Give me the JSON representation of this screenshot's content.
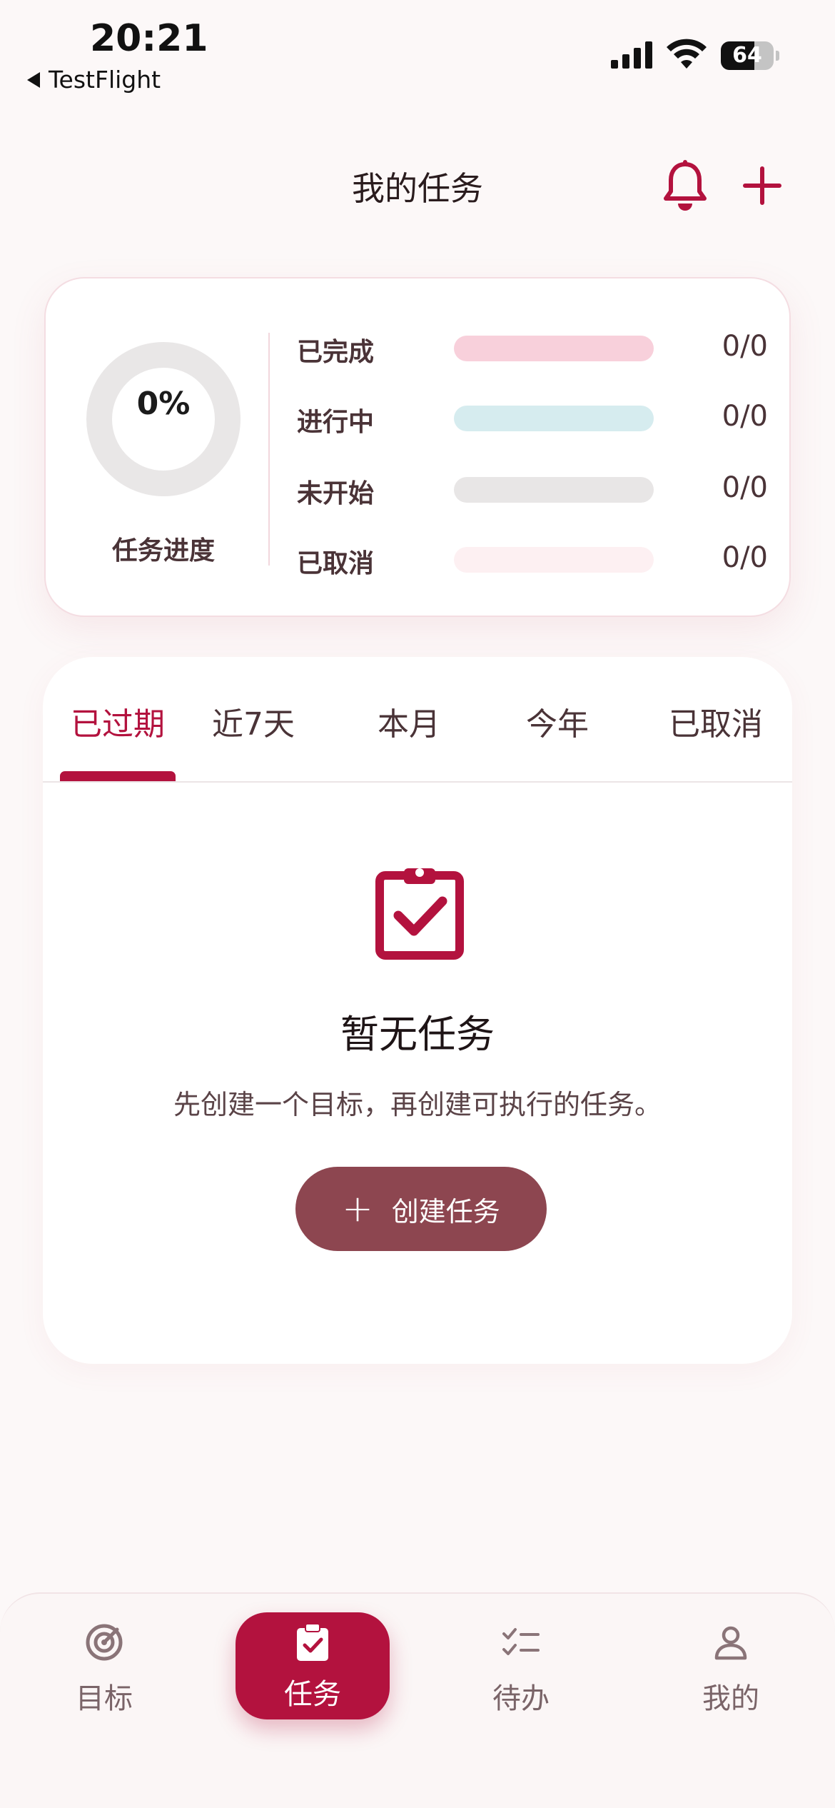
{
  "status_bar": {
    "time": "20:21",
    "back_app": "TestFlight",
    "battery": "64",
    "battery_level": 0.64
  },
  "header": {
    "title": "我的任务",
    "accent_color": "#b3123e"
  },
  "progress": {
    "percent_label": "0%",
    "percent": 0,
    "caption": "任务进度",
    "stats": [
      {
        "label": "已完成",
        "value": "0/0",
        "ratio": 0,
        "track_color": "#f8d0db",
        "fill_color": "#e88aa3"
      },
      {
        "label": "进行中",
        "value": "0/0",
        "ratio": 0,
        "track_color": "#d6ecef",
        "fill_color": "#7fc3cc"
      },
      {
        "label": "未开始",
        "value": "0/0",
        "ratio": 0,
        "track_color": "#e8e6e6",
        "fill_color": "#b8b4b4"
      },
      {
        "label": "已取消",
        "value": "0/0",
        "ratio": 0,
        "track_color": "#fdf0f2",
        "fill_color": "#f2c6cf"
      }
    ]
  },
  "tabs": {
    "items": [
      {
        "label": "已过期",
        "active": true
      },
      {
        "label": "近7天",
        "active": false
      },
      {
        "label": "本月",
        "active": false
      },
      {
        "label": "今年",
        "active": false
      },
      {
        "label": "已取消",
        "active": false
      }
    ]
  },
  "empty_state": {
    "icon": "clipboard-check-icon",
    "title": "暂无任务",
    "description": "先创建一个目标，再创建可执行的任务。",
    "button_label": "创建任务",
    "button_color": "#8d4650"
  },
  "bottom_nav": {
    "items": [
      {
        "label": "目标",
        "icon": "target-icon",
        "active": false
      },
      {
        "label": "任务",
        "icon": "clipboard-check-icon",
        "active": true
      },
      {
        "label": "待办",
        "icon": "checklist-icon",
        "active": false
      },
      {
        "label": "我的",
        "icon": "user-icon",
        "active": false
      }
    ]
  }
}
